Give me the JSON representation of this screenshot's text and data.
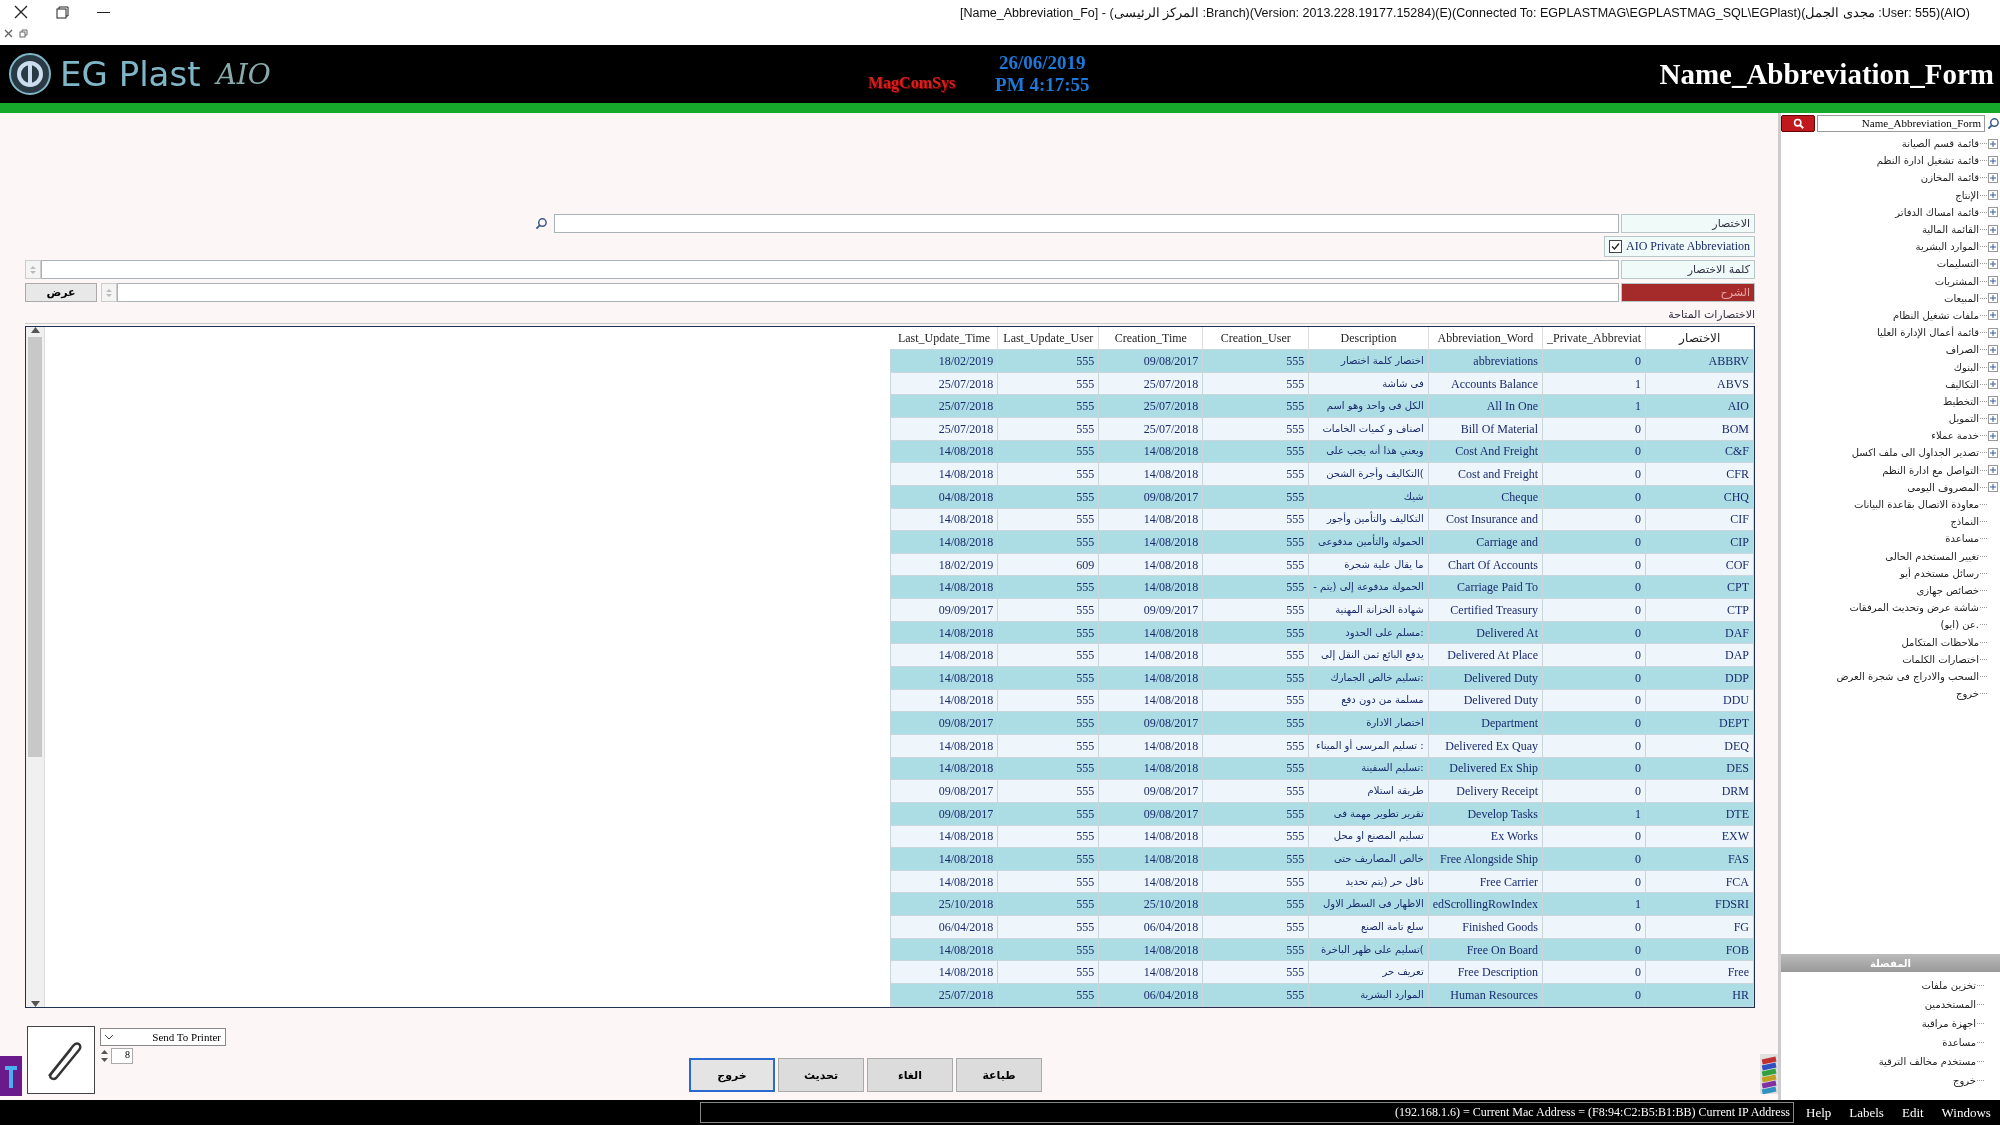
{
  "window": {
    "title": "[Name_Abbreviation_Fo] - (المركز الرئيسى :Branch)(Version: 2013.228.19177.15284)(E)(Connected To: EGPLASTMAG\\EGPLASTMAG_SQL\\EGPlast)(مجدى الجمل :User: 555)(AIO)"
  },
  "header": {
    "brand": "EG Plast",
    "brand_mark": "AIO",
    "vendor": "MagComSys",
    "date": "26/06/2019",
    "time": "PM 4:17:55",
    "form_title": "Name_Abbreviation_Form"
  },
  "form": {
    "abbreviation_label": "الاختصار",
    "private_checkbox": {
      "label": "AIO Private Abbreviation",
      "checked": true
    },
    "word_label": "كلمة الاختصار",
    "description_label": "الشرح",
    "show_button": "عرض",
    "list_label": "الاختصارات المتاحة"
  },
  "table": {
    "columns": [
      "Last_Update_Time",
      "Last_Update_User",
      "Creation_Time",
      "Creation_User",
      "Description",
      "Abbreviation_Word",
      "_Private_Abbreviat",
      "الاختصار"
    ],
    "rows": [
      {
        "cells": [
          "18/02/2019",
          "555",
          "09/08/2017",
          "555",
          "اختصار كلمة اختصار",
          "abbreviations",
          "0",
          "ABBRV"
        ]
      },
      {
        "cells": [
          "25/07/2018",
          "555",
          "25/07/2018",
          "555",
          "فى شاشة",
          "Accounts Balance",
          "1",
          "ABVS"
        ]
      },
      {
        "cells": [
          "25/07/2018",
          "555",
          "25/07/2018",
          "555",
          "الكل فى واحد وهو اسم",
          "All In One",
          "1",
          "AIO"
        ]
      },
      {
        "cells": [
          "25/07/2018",
          "555",
          "25/07/2018",
          "555",
          "اصناف و كميات الخامات",
          "Bill Of Material",
          "0",
          "BOM"
        ]
      },
      {
        "cells": [
          "14/08/2018",
          "555",
          "14/08/2018",
          "555",
          "ويعني هذا أنه يجب على",
          "Cost And Freight",
          "0",
          "C&F"
        ]
      },
      {
        "cells": [
          "14/08/2018",
          "555",
          "14/08/2018",
          "555",
          "التكاليف وأجرة الشحن(",
          "Cost and Freight",
          "0",
          "CFR"
        ]
      },
      {
        "cells": [
          "04/08/2018",
          "555",
          "09/08/2017",
          "555",
          "شيك",
          "Cheque",
          "0",
          "CHQ"
        ]
      },
      {
        "cells": [
          "14/08/2018",
          "555",
          "14/08/2018",
          "555",
          "التكاليف والتأمين وأجور",
          "Cost Insurance and",
          "0",
          "CIF"
        ]
      },
      {
        "cells": [
          "14/08/2018",
          "555",
          "14/08/2018",
          "555",
          "الحمولة والتأمين مدفوعى",
          "Carriage and",
          "0",
          "CIP"
        ]
      },
      {
        "cells": [
          "18/02/2019",
          "609",
          "14/08/2018",
          "555",
          "ما يقال علية شجرة",
          "Chart Of Accounts",
          "0",
          "COF"
        ]
      },
      {
        "cells": [
          "14/08/2018",
          "555",
          "14/08/2018",
          "555",
          "- الحمولة مدفوعة إلى (يتم",
          "Carriage Paid To",
          "0",
          "CPT"
        ]
      },
      {
        "cells": [
          "09/09/2017",
          "555",
          "09/09/2017",
          "555",
          "شهادة الخزانة المهنية",
          "Certified Treasury",
          "0",
          "CTP"
        ]
      },
      {
        "cells": [
          "14/08/2018",
          "555",
          "14/08/2018",
          "555",
          "مسلم على الحدود:",
          "Delivered At",
          "0",
          "DAF"
        ]
      },
      {
        "cells": [
          "14/08/2018",
          "555",
          "14/08/2018",
          "555",
          "يدفع البائع ثمن النقل إلى",
          "Delivered At Place",
          "0",
          "DAP"
        ]
      },
      {
        "cells": [
          "14/08/2018",
          "555",
          "14/08/2018",
          "555",
          "تسليم خالص الجمارك:",
          "Delivered Duty",
          "0",
          "DDP"
        ]
      },
      {
        "cells": [
          "14/08/2018",
          "555",
          "14/08/2018",
          "555",
          "مسلمة من دون دفع",
          "Delivered Duty",
          "0",
          "DDU"
        ]
      },
      {
        "cells": [
          "09/08/2017",
          "555",
          "09/08/2017",
          "555",
          "اختصار الادارة",
          "Department",
          "0",
          "DEPT"
        ]
      },
      {
        "cells": [
          "14/08/2018",
          "555",
          "14/08/2018",
          "555",
          "تسليم المرسى أو الميناء :",
          "Delivered Ex Quay",
          "0",
          "DEQ"
        ]
      },
      {
        "cells": [
          "14/08/2018",
          "555",
          "14/08/2018",
          "555",
          "تسليم السفينة:",
          "Delivered Ex Ship",
          "0",
          "DES"
        ]
      },
      {
        "cells": [
          "09/08/2017",
          "555",
          "09/08/2017",
          "555",
          "طريقة استلام",
          "Delivery Receipt",
          "0",
          "DRM"
        ]
      },
      {
        "cells": [
          "09/08/2017",
          "555",
          "09/08/2017",
          "555",
          "تقرير تطوير مهمة فى",
          "Develop Tasks",
          "1",
          "DTE"
        ]
      },
      {
        "cells": [
          "14/08/2018",
          "555",
          "14/08/2018",
          "555",
          "تسليم المصنع او محل",
          "Ex Works",
          "0",
          "EXW"
        ]
      },
      {
        "cells": [
          "14/08/2018",
          "555",
          "14/08/2018",
          "555",
          "خالص المصاريف حتى",
          "Free Alongside Ship",
          "0",
          "FAS"
        ]
      },
      {
        "cells": [
          "14/08/2018",
          "555",
          "14/08/2018",
          "555",
          "ناقل حر (يتم تحديد",
          "Free Carrier",
          "0",
          "FCA"
        ]
      },
      {
        "cells": [
          "25/10/2018",
          "555",
          "25/10/2018",
          "555",
          "الاظهار فى السطر الاول",
          "edScrollingRowIndex",
          "1",
          "FDSRI"
        ]
      },
      {
        "cells": [
          "06/04/2018",
          "555",
          "06/04/2018",
          "555",
          "سلع تامة الصنع",
          "Finished Goods",
          "0",
          "FG"
        ]
      },
      {
        "cells": [
          "14/08/2018",
          "555",
          "14/08/2018",
          "555",
          "تسليم على ظهر الباخرة(",
          "Free On Board",
          "0",
          "FOB"
        ]
      },
      {
        "cells": [
          "14/08/2018",
          "555",
          "14/08/2018",
          "555",
          "تعريف حر",
          "Free Description",
          "0",
          "Free"
        ]
      },
      {
        "cells": [
          "25/07/2018",
          "555",
          "06/04/2018",
          "555",
          "الموارد البشرية",
          "Human Resources",
          "0",
          "HR"
        ]
      }
    ]
  },
  "bottom": {
    "printer": "Send To Printer",
    "copies": "8",
    "buttons": [
      {
        "label": "طباعة",
        "focused": false
      },
      {
        "label": "الغاء",
        "focused": false
      },
      {
        "label": "تحديث",
        "focused": false
      },
      {
        "label": "خروج",
        "focused": true
      }
    ]
  },
  "sidebar": {
    "search_value": "Name_Abbreviation_Form",
    "items": [
      {
        "label": "قائمة قسم الصيانة",
        "kind": "group"
      },
      {
        "label": "قائمة تشغيل ادارة النظم",
        "kind": "group"
      },
      {
        "label": "قائمة المخازن",
        "kind": "group"
      },
      {
        "label": "الإنتاج",
        "kind": "group"
      },
      {
        "label": "قائمة امساك الدفاتر",
        "kind": "group"
      },
      {
        "label": "القائمة المالية",
        "kind": "group"
      },
      {
        "label": "الموارد البشرية",
        "kind": "group"
      },
      {
        "label": "التسليمات",
        "kind": "group"
      },
      {
        "label": "المشتريات",
        "kind": "group"
      },
      {
        "label": "المبيعات",
        "kind": "group"
      },
      {
        "label": "ملفات تشغيل النظام",
        "kind": "group"
      },
      {
        "label": "قائمة أعمال الإدارة العليا",
        "kind": "group"
      },
      {
        "label": "الصراف",
        "kind": "group"
      },
      {
        "label": "البنوك",
        "kind": "group"
      },
      {
        "label": "التكاليف",
        "kind": "group"
      },
      {
        "label": "التخطيط",
        "kind": "group"
      },
      {
        "label": "التمويل",
        "kind": "group"
      },
      {
        "label": "خدمة عملاء",
        "kind": "group"
      },
      {
        "label": "تصدير الجداول الى ملف اكسل",
        "kind": "group"
      },
      {
        "label": "التواصل مع ادارة النظم",
        "kind": "group"
      },
      {
        "label": "المصروف اليومى",
        "kind": "group"
      },
      {
        "label": "معاودة الاتصال بقاعدة البيانات",
        "kind": "leaf"
      },
      {
        "label": "النماذج",
        "kind": "leaf"
      },
      {
        "label": "مساعدة",
        "kind": "leaf"
      },
      {
        "label": "تغيير المستخدم الحالى",
        "kind": "leaf"
      },
      {
        "label": "رسائل مستخدم أيو",
        "kind": "leaf"
      },
      {
        "label": "خصائص جهازى",
        "kind": "leaf"
      },
      {
        "label": "شاشة عرض وتحديث المرفقات",
        "kind": "leaf"
      },
      {
        "label": "عن (ايو).",
        "kind": "leaf"
      },
      {
        "label": "ملاحظات المتكامل",
        "kind": "leaf"
      },
      {
        "label": "اختصارات الكلمات",
        "kind": "leaf"
      },
      {
        "label": "السحب والادراج فى شجرة العرض",
        "kind": "leaf"
      },
      {
        "label": "خروج",
        "kind": "leaf"
      }
    ],
    "favorites_title": "المفضلة",
    "favorites": [
      "تخزين ملفات",
      "المستخدمين",
      "اجهزة مراقبة",
      "مساعدة",
      "مستخدم مخالف الترقية",
      "خروج"
    ]
  },
  "status_bar": {
    "network": "(192.168.1.6) = Current Mac Address = (F8:94:C2:B5:B1:BB) Current IP Address",
    "menu": [
      "Help",
      "Labels",
      "Edit",
      "Windows"
    ]
  }
}
